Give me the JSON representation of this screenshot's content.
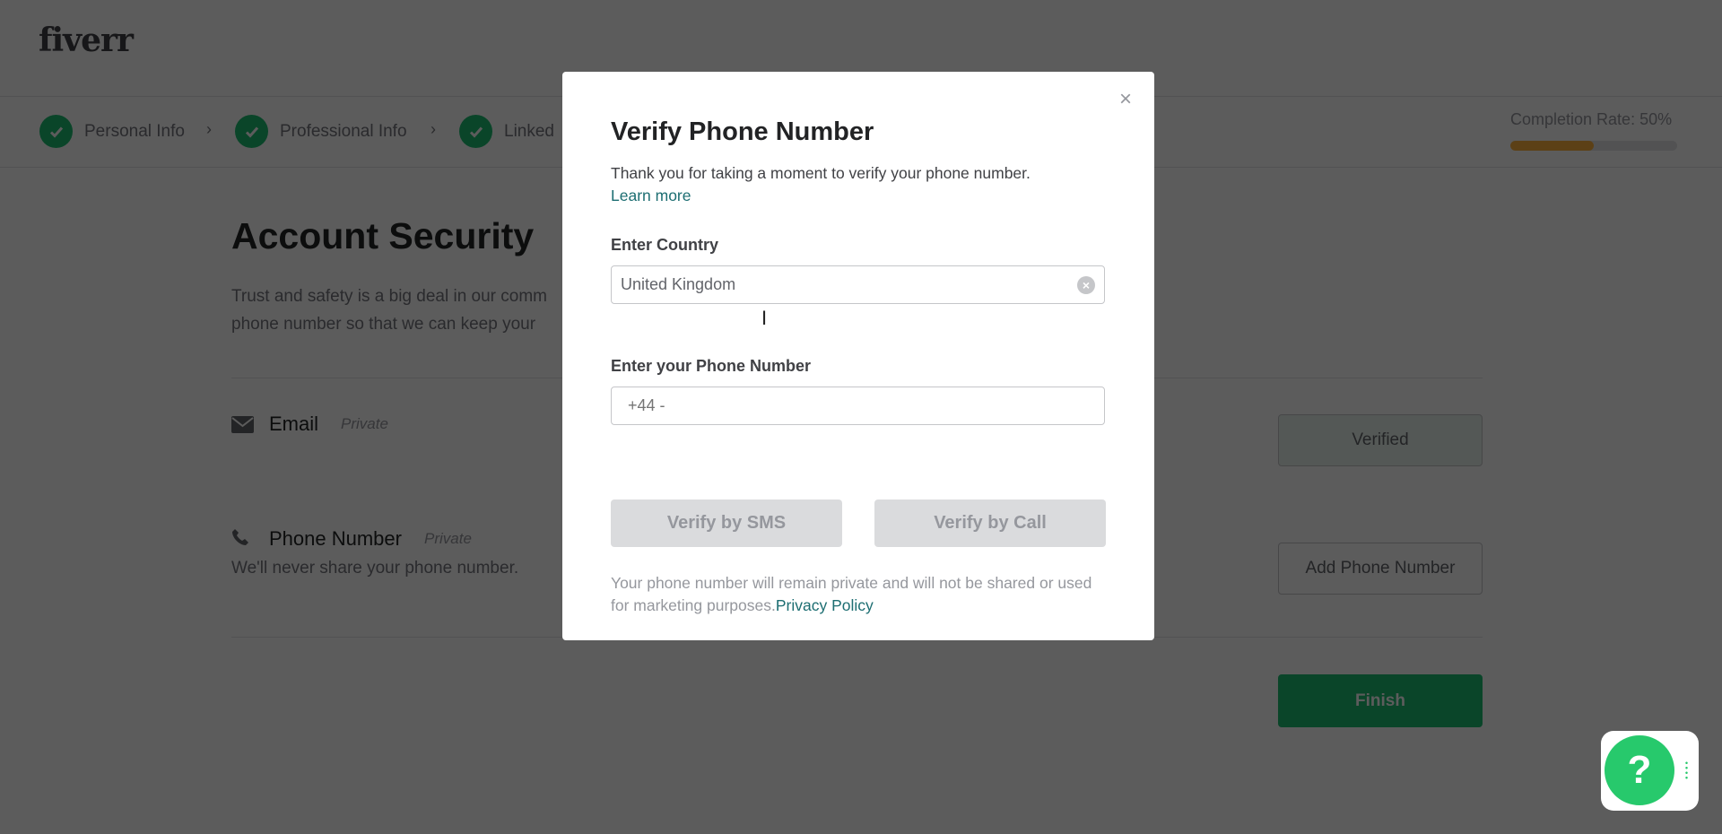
{
  "header": {
    "logo": "fiverr"
  },
  "steps": [
    {
      "label": "Personal Info",
      "done": true
    },
    {
      "label": "Professional Info",
      "done": true
    },
    {
      "label": "Linked",
      "done": true
    }
  ],
  "completion": {
    "label": "Completion Rate: 50%",
    "value": 50,
    "color": "#ffb33e"
  },
  "page": {
    "title": "Account Security",
    "intro_line1": "Trust and safety is a big deal in our comm",
    "intro_line2": "phone number so that we can keep your",
    "email": {
      "label": "Email",
      "privacy": "Private",
      "button": "Verified",
      "icon": "envelope-icon"
    },
    "phone": {
      "label": "Phone Number",
      "privacy": "Private",
      "note": "We'll never share your phone number.",
      "button": "Add Phone Number",
      "icon": "phone-icon"
    },
    "finish": "Finish"
  },
  "modal": {
    "title": "Verify Phone Number",
    "description": "Thank you for taking a moment to verify your phone number.",
    "learn_more": "Learn more",
    "country_label": "Enter Country",
    "country_value": "United Kingdom",
    "phone_label": "Enter your Phone Number",
    "phone_placeholder": "+44 -",
    "sms_button": "Verify by SMS",
    "call_button": "Verify by Call",
    "footer": "Your phone number will remain private and will not be shared or used for marketing purposes.",
    "privacy_link": "Privacy Policy",
    "close": "×"
  },
  "help": {
    "label": "?"
  },
  "colors": {
    "brand": "#1dbf73",
    "link": "#1d6e72",
    "finish": "#1dbf73"
  }
}
